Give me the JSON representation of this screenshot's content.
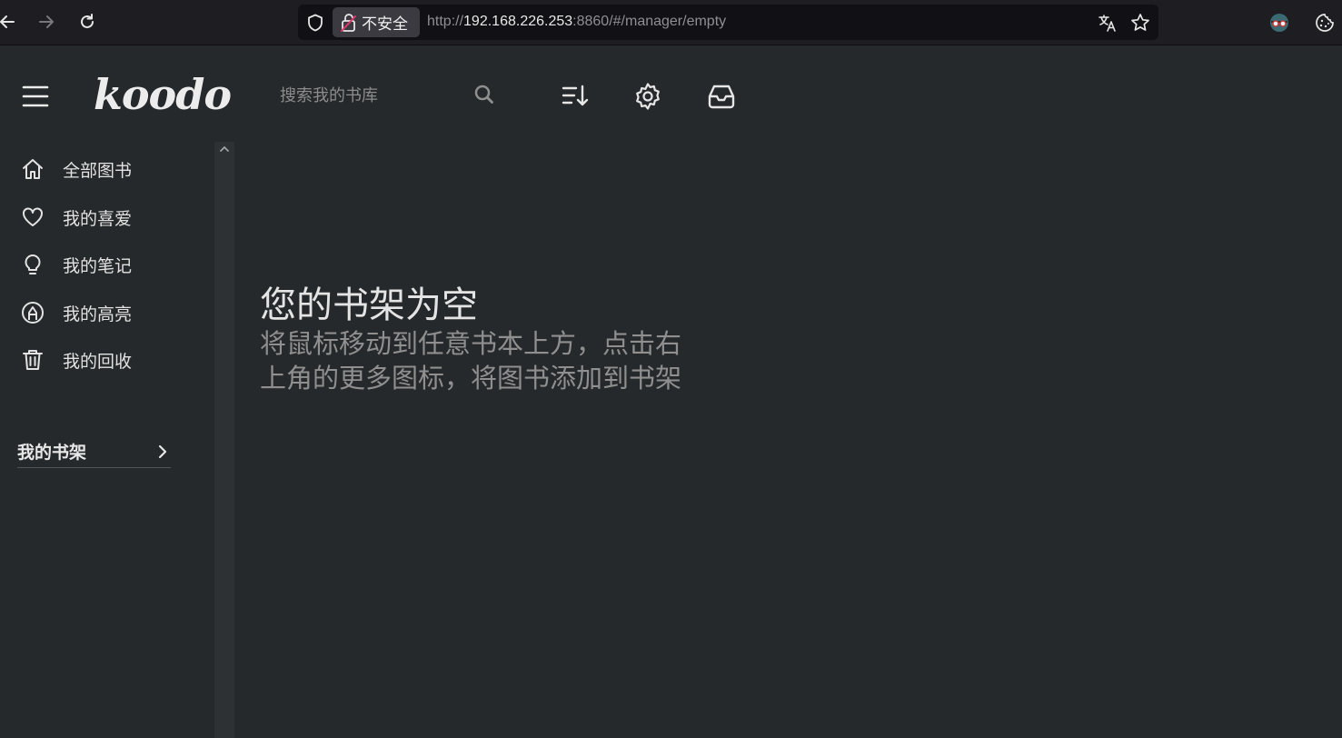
{
  "browser": {
    "security_label": "不安全",
    "url_prefix": "http://",
    "url_host": "192.168.226.253",
    "url_rest": ":8860/#/manager/empty",
    "icons": [
      "back-icon",
      "forward-icon",
      "reload-icon",
      "shield-icon",
      "insecure-lock-icon",
      "translate-icon",
      "bookmark-star-icon",
      "extension-avatar-icon",
      "cookie-icon"
    ]
  },
  "header": {
    "logo": "koodo",
    "search_placeholder": "搜索我的书库",
    "icons": [
      "menu-icon",
      "search-icon",
      "sort-icon",
      "settings-icon",
      "inbox-icon"
    ]
  },
  "sidebar": {
    "items": [
      {
        "label": "全部图书",
        "icon": "home-icon"
      },
      {
        "label": "我的喜爱",
        "icon": "heart-icon"
      },
      {
        "label": "我的笔记",
        "icon": "bulb-icon"
      },
      {
        "label": "我的高亮",
        "icon": "highlighter-icon"
      },
      {
        "label": "我的回收",
        "icon": "trash-icon"
      }
    ],
    "shelf_label": "我的书架"
  },
  "empty": {
    "title": "您的书架为空",
    "description_line1": "将鼠标移动到任意书本上方，点击右",
    "description_line2": "上角的更多图标，将图书添加到书架"
  },
  "colors": {
    "background": "#25292b",
    "browser_bar": "#1e1e22",
    "url_box": "#111115",
    "text_primary": "#e4e4e4",
    "text_secondary": "#8f8f8f"
  }
}
